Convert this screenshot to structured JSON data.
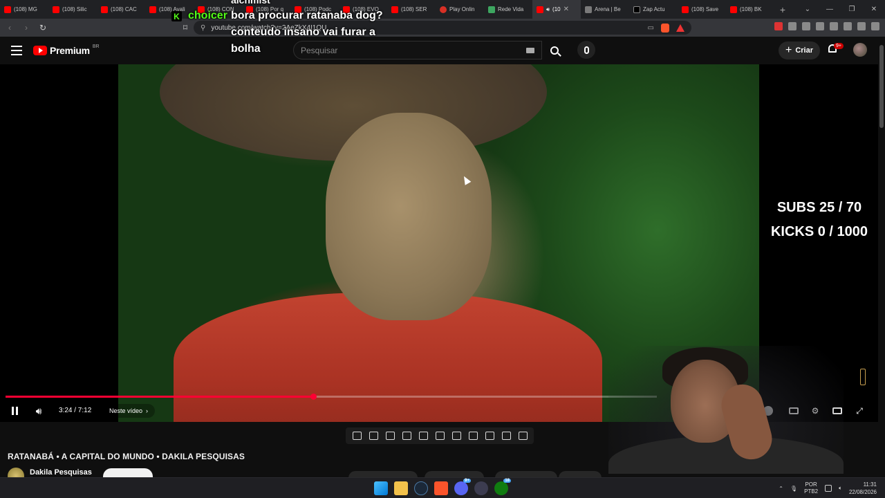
{
  "browser": {
    "tabs": [
      {
        "label": "(108) MG",
        "icon": "yt"
      },
      {
        "label": "(108) Silic",
        "icon": "yt"
      },
      {
        "label": "(108) CAC",
        "icon": "yt"
      },
      {
        "label": "(108) Avali",
        "icon": "yt"
      },
      {
        "label": "(108) CON",
        "icon": "yt"
      },
      {
        "label": "(108) Por q",
        "icon": "yt"
      },
      {
        "label": "(108) Podc",
        "icon": "yt"
      },
      {
        "label": "(108) EVO",
        "icon": "yt"
      },
      {
        "label": "(108) SER",
        "icon": "yt"
      },
      {
        "label": "Play Onlin",
        "icon": "play"
      },
      {
        "label": "Rede Vida",
        "icon": "rv"
      },
      {
        "label": "(10",
        "icon": "yt",
        "active": true
      },
      {
        "label": "Arena | Be",
        "icon": "gr"
      },
      {
        "label": "Zap Actu",
        "icon": "x"
      },
      {
        "label": "(108) Save",
        "icon": "yt"
      },
      {
        "label": "(108) BK",
        "icon": "yt"
      }
    ],
    "new_tab": "+",
    "url": "youtube.com/watch?v=2AeZkX4I1QU"
  },
  "chat_overlay": {
    "top_line": "alchmist",
    "username": "choicer",
    "message_line1": "bora procurar ratanaba dog?",
    "message_line2": "conteudo insano vai furar a",
    "message_line3": "bolha"
  },
  "youtube": {
    "logo_text": "Premium",
    "region": "BR",
    "search_placeholder": "Pesquisar",
    "create_label": "Criar",
    "notifications_badge": "9+"
  },
  "player": {
    "current_time": "3:24",
    "duration": "7:12",
    "time_display": "3:24 / 7:12",
    "progress_fraction": 0.472,
    "chapter_label": "Neste vídeo",
    "goals_line1": "SUBS 25 / 70",
    "goals_line2": "KICKS 0 / 1000"
  },
  "video": {
    "title": "RATANABÁ • A CAPITAL DO MUNDO • DAKILA PESQUISAS",
    "channel": "Dakila Pesquisas"
  },
  "taskbar": {
    "discord_badge": "9+",
    "xbox_badge": "18",
    "lang_line1": "POR",
    "lang_line2": "PTB2",
    "time": "11:31",
    "date": "22/08/2026"
  },
  "colors": {
    "yt_red": "#ff0000",
    "progress_red": "#ff0033",
    "kick_green": "#53fc18"
  }
}
